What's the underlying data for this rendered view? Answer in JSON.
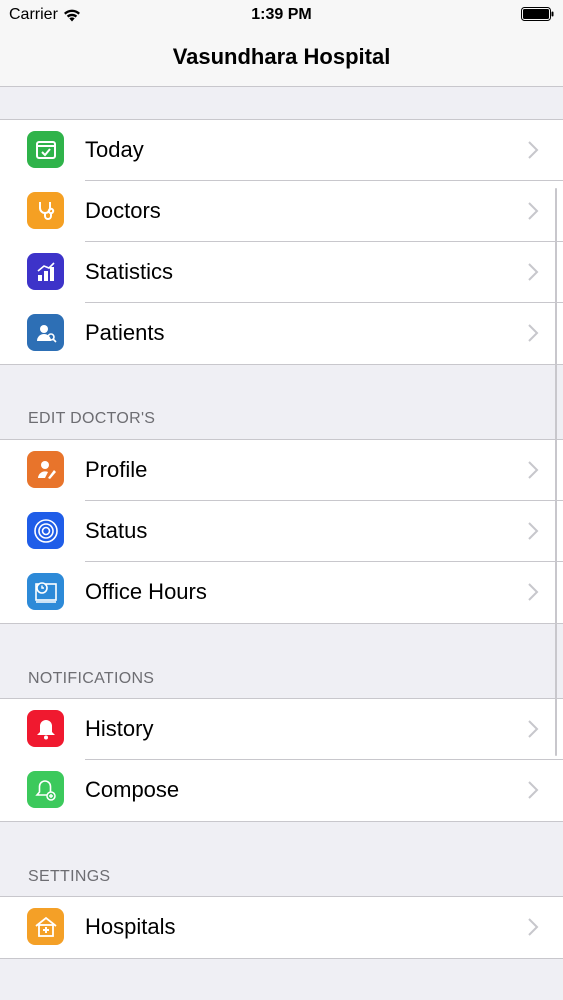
{
  "status_bar": {
    "carrier": "Carrier",
    "time": "1:39 PM"
  },
  "nav": {
    "title": "Vasundhara Hospital"
  },
  "groups": [
    {
      "header": "",
      "items": [
        {
          "label": "Today",
          "icon": "calendar-check-icon",
          "color": "#2fb34a"
        },
        {
          "label": "Doctors",
          "icon": "stethoscope-icon",
          "color": "#f5a023"
        },
        {
          "label": "Statistics",
          "icon": "chart-icon",
          "color": "#3d33c9"
        },
        {
          "label": "Patients",
          "icon": "patient-search-icon",
          "color": "#2d6fb5"
        }
      ]
    },
    {
      "header": "EDIT DOCTOR'S",
      "items": [
        {
          "label": "Profile",
          "icon": "profile-edit-icon",
          "color": "#e8742b"
        },
        {
          "label": "Status",
          "icon": "status-circle-icon",
          "color": "#1f5de8"
        },
        {
          "label": "Office Hours",
          "icon": "clock-icon",
          "color": "#2d8ad8"
        }
      ]
    },
    {
      "header": "NOTIFICATIONS",
      "items": [
        {
          "label": "History",
          "icon": "bell-icon",
          "color": "#f0192f"
        },
        {
          "label": "Compose",
          "icon": "bell-add-icon",
          "color": "#3cc95c"
        }
      ]
    },
    {
      "header": "SETTINGS",
      "items": [
        {
          "label": "Hospitals",
          "icon": "hospital-icon",
          "color": "#f4a027"
        }
      ]
    }
  ]
}
